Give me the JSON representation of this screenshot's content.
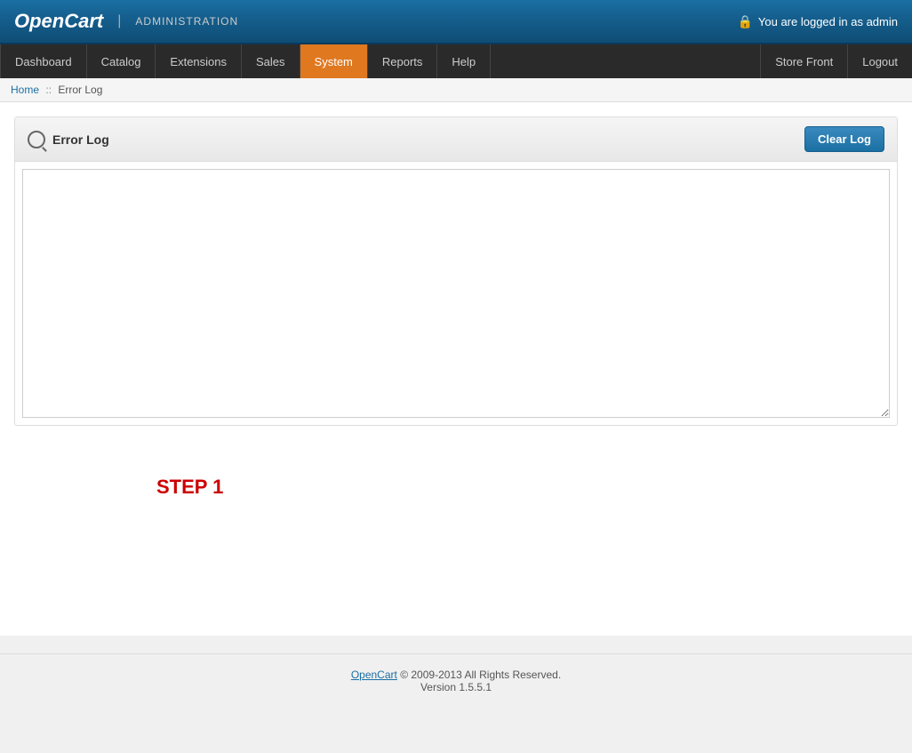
{
  "header": {
    "logo": "OpenCart",
    "separator": "|",
    "admin_label": "ADMINISTRATION",
    "logged_in": "You are logged in as admin"
  },
  "nav": {
    "left_items": [
      {
        "label": "Dashboard",
        "active": false
      },
      {
        "label": "Catalog",
        "active": false
      },
      {
        "label": "Extensions",
        "active": false
      },
      {
        "label": "Sales",
        "active": false
      },
      {
        "label": "System",
        "active": true
      },
      {
        "label": "Reports",
        "active": false
      },
      {
        "label": "Help",
        "active": false
      }
    ],
    "right_items": [
      {
        "label": "Store Front"
      },
      {
        "label": "Logout"
      }
    ]
  },
  "breadcrumb": {
    "home": "Home",
    "separator": "::",
    "current": "Error Log"
  },
  "panel": {
    "title": "Error Log",
    "clear_log_label": "Clear Log",
    "log_content": ""
  },
  "step_text": "STEP 1",
  "footer": {
    "brand": "OpenCart",
    "copyright": "© 2009-2013 All Rights Reserved.",
    "version": "Version 1.5.5.1"
  }
}
